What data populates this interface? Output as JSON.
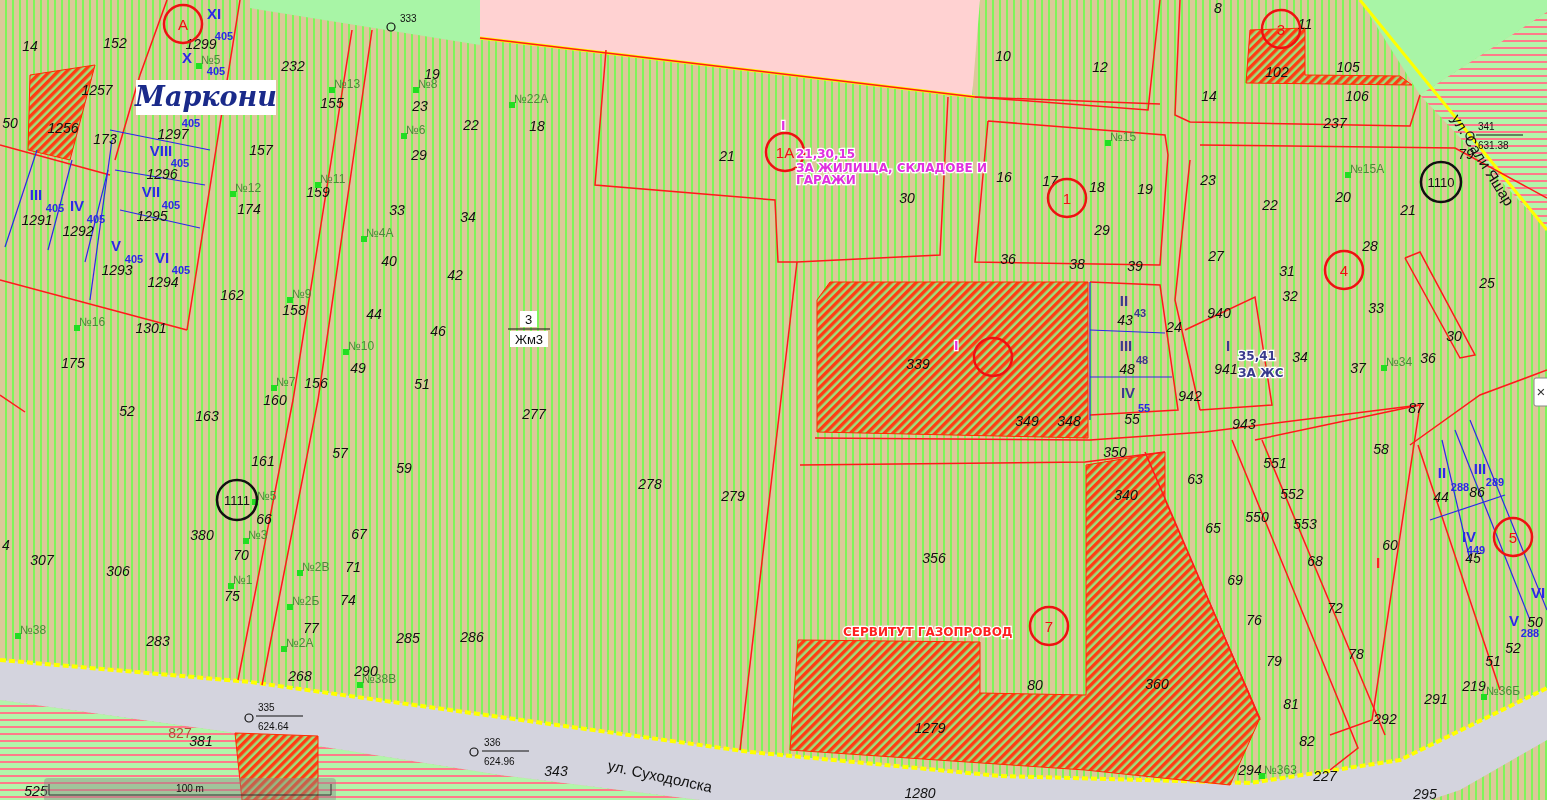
{
  "map": {
    "logo": "Маркони",
    "scale_bar": "100 m",
    "close_button": "×",
    "zone_label": {
      "number": "3",
      "code": "Жм3"
    },
    "parcels": [
      "14",
      "152",
      "50",
      "1257",
      "1256",
      "173",
      "1299",
      "1297",
      "1296",
      "1295",
      "1291",
      "1292",
      "1293",
      "1294",
      "232",
      "155",
      "157",
      "174",
      "159",
      "19",
      "23",
      "22",
      "18",
      "29",
      "33",
      "34",
      "40",
      "42",
      "44",
      "46",
      "49",
      "51",
      "162",
      "158",
      "1301",
      "175",
      "52",
      "163",
      "156",
      "160",
      "161",
      "66",
      "380",
      "70",
      "4",
      "307",
      "306",
      "75",
      "57",
      "59",
      "67",
      "71",
      "74",
      "77",
      "283",
      "285",
      "286",
      "268",
      "290",
      "381",
      "525",
      "21",
      "30",
      "277",
      "278",
      "279",
      "356",
      "343",
      "1280",
      "10",
      "12",
      "8",
      "11",
      "102",
      "105",
      "14",
      "106",
      "237",
      "16",
      "17",
      "18",
      "19",
      "29",
      "36",
      "38",
      "39",
      "23",
      "22",
      "20",
      "21",
      "79",
      "27",
      "31",
      "28",
      "32",
      "33",
      "25",
      "30",
      "34",
      "37",
      "36",
      "940",
      "941",
      "942",
      "24",
      "43",
      "48",
      "55",
      "339",
      "349",
      "348",
      "943",
      "87",
      "58",
      "60",
      "350",
      "340",
      "63",
      "65",
      "69",
      "76",
      "79",
      "81",
      "82",
      "294",
      "227",
      "551",
      "552",
      "550",
      "553",
      "68",
      "72",
      "78",
      "292",
      "291",
      "219",
      "51",
      "52",
      "44",
      "86",
      "45",
      "50",
      "360",
      "1279",
      "80",
      "295"
    ],
    "lot_numbers": [
      "827"
    ],
    "addresses": [
      "№5",
      "№13",
      "№8",
      "№22А",
      "№6",
      "№12",
      "№11",
      "№4А",
      "№9",
      "№16",
      "№10",
      "№7",
      "№5",
      "№3",
      "№2В",
      "№1",
      "№2Б",
      "№2А",
      "№38",
      "№38В",
      "№15",
      "№15А",
      "№34",
      "№36Б",
      "№363"
    ],
    "sections": [
      {
        "text": "XI",
        "color": "#2a2ae6"
      },
      {
        "text": "X",
        "color": "#2a2ae6"
      },
      {
        "text": "VIII",
        "color": "#2a2ae6"
      },
      {
        "text": "VII",
        "color": "#2a2ae6"
      },
      {
        "text": "III",
        "color": "#2a2ae6"
      },
      {
        "text": "IV",
        "color": "#2a2ae6"
      },
      {
        "text": "V",
        "color": "#2a2ae6"
      },
      {
        "text": "VI",
        "color": "#2a2ae6"
      },
      {
        "text": "II",
        "color": "#3a3a8c"
      },
      {
        "text": "III",
        "color": "#3a3a8c"
      },
      {
        "text": "IV",
        "color": "#3a3a8c"
      },
      {
        "text": "I",
        "color": "#3a3a8c"
      },
      {
        "text": "II",
        "color": "#2a2ae6"
      },
      {
        "text": "III",
        "color": "#2a2ae6"
      },
      {
        "text": "IV",
        "color": "#2a2ae6"
      },
      {
        "text": "VI",
        "color": "#2a2ae6"
      },
      {
        "text": "V",
        "color": "#2a2ae6"
      },
      {
        "text": "I",
        "color": "#ff2020"
      }
    ],
    "plot_codes": [
      {
        "text": "405",
        "color": "#2a2ae6"
      },
      {
        "text": "405",
        "color": "#2a2ae6"
      },
      {
        "text": "405",
        "color": "#2a2ae6"
      },
      {
        "text": "405",
        "color": "#2a2ae6"
      },
      {
        "text": "405",
        "color": "#2a2ae6"
      },
      {
        "text": "405",
        "color": "#2a2ae6"
      },
      {
        "text": "405",
        "color": "#2a2ae6"
      },
      {
        "text": "405",
        "color": "#2a2ae6"
      },
      {
        "text": "405",
        "color": "#2a2ae6"
      },
      {
        "text": "43",
        "color": "#3a3a8c"
      },
      {
        "text": "48",
        "color": "#3a3a8c"
      },
      {
        "text": "55",
        "color": "#2a2ae6"
      },
      {
        "text": "288",
        "color": "#2a2ae6"
      },
      {
        "text": "289",
        "color": "#2a2ae6"
      },
      {
        "text": "449",
        "color": "#2a2ae6"
      },
      {
        "text": "288",
        "color": "#2a2ae6"
      }
    ],
    "zone_markers": [
      {
        "kind": "zone",
        "text": "А"
      },
      {
        "kind": "zone",
        "text": "1А"
      },
      {
        "kind": "zone",
        "text": "1"
      },
      {
        "kind": "zone",
        "text": "3"
      },
      {
        "kind": "zone",
        "text": "4"
      },
      {
        "kind": "zone",
        "text": "5"
      },
      {
        "kind": "zone",
        "text": "7"
      },
      {
        "kind": "ring"
      },
      {
        "kind": "reference",
        "text": "1110"
      },
      {
        "kind": "reference",
        "text": "1111"
      }
    ],
    "notes": [
      {
        "text": "I",
        "color": "#e030e0"
      },
      {
        "text": "21,30,15",
        "color": "#e030e0"
      },
      {
        "text": "ЗА ЖИЛИЩА, СКЛАДОВЕ И",
        "color": "#e030e0"
      },
      {
        "text": "ГАРАЖИ",
        "color": "#e030e0"
      },
      {
        "text": "I",
        "color": "#e030e0"
      },
      {
        "text": "35,41",
        "color": "#3a3a8c"
      },
      {
        "text": "ЗА ЖС",
        "color": "#3a3a8c"
      },
      {
        "text": "СЕРВИТУТ ГАЗОПРОВОД",
        "color": "#ff2020"
      }
    ],
    "streets": [
      "ул. Суходолска",
      "ул. Сали Яшар"
    ],
    "survey_points": [
      {
        "number": "333"
      },
      {
        "number": "335",
        "elevation": "624.64"
      },
      {
        "number": "336",
        "elevation": "624.96"
      },
      {
        "number": "341",
        "elevation": "631.38"
      }
    ]
  }
}
